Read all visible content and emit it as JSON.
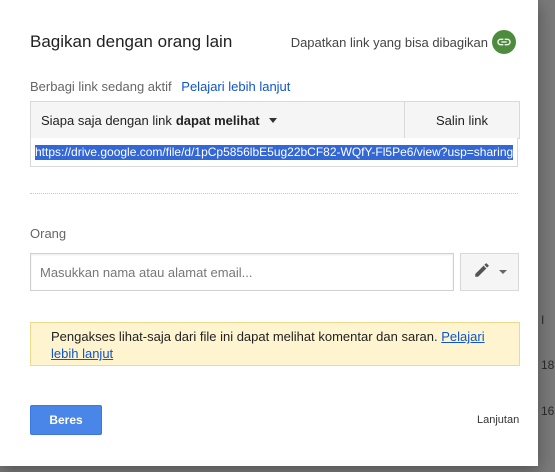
{
  "background": {
    "frag1": "I",
    "frag2": "18",
    "frag3": "16"
  },
  "dialog": {
    "title": "Bagikan dengan orang lain",
    "get_link_label": "Dapatkan link yang bisa dibagikan",
    "link_sharing": {
      "status_text": "Berbagi link sedang aktif",
      "learn_more": "Pelajari lebih lanjut",
      "access_prefix": "Siapa saja dengan link",
      "access_level": "dapat melihat",
      "copy_link": "Salin link",
      "url": "https://drive.google.com/file/d/1pCp5856lbE5ug22bCF82-WQfY-Fl5Pe6/view?usp=sharing"
    },
    "people": {
      "label": "Orang",
      "placeholder": "Masukkan nama atau alamat email..."
    },
    "notice": {
      "text": "Pengakses lihat-saja dari file ini dapat melihat komentar dan saran.",
      "learn_more": "Pelajari lebih lanjut"
    },
    "done_button": "Beres",
    "advanced": "Lanjutan"
  },
  "colors": {
    "accent": "#4a86e8",
    "link": "#1155cc",
    "link_icon_bg": "#4c8c3c",
    "notice_bg": "#fef4d0"
  },
  "icons": {
    "get_link": "link-icon",
    "permission": "pencil-icon",
    "access_dropdown": "caret-down-icon"
  }
}
